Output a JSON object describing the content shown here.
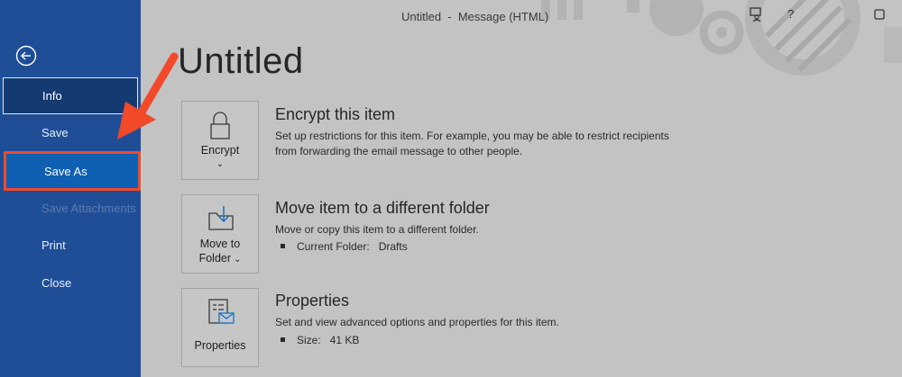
{
  "window": {
    "title": "Untitled  -  Message (HTML)"
  },
  "sidebar": {
    "items": [
      {
        "label": "Info"
      },
      {
        "label": "Save"
      },
      {
        "label": "Save As"
      },
      {
        "label": "Save Attachments"
      },
      {
        "label": "Print"
      },
      {
        "label": "Close"
      }
    ]
  },
  "main": {
    "title": "Untitled",
    "sections": [
      {
        "tile_label": "Encrypt",
        "title": "Encrypt this item",
        "desc_line1": "Set up restrictions for this item. For example, you may be able to restrict recipients",
        "desc_line2": "from forwarding the email message to other people."
      },
      {
        "tile_label_line1": "Move to",
        "tile_label_line2": "Folder",
        "title": "Move item to a different folder",
        "desc": "Move or copy this item to a different folder.",
        "bullet_label": "Current Folder:",
        "bullet_value": "Drafts"
      },
      {
        "tile_label": "Properties",
        "title": "Properties",
        "desc": "Set and view advanced options and properties for this item.",
        "bullet_label": "Size:",
        "bullet_value": "41 KB"
      }
    ]
  },
  "icons": {
    "back": "back-arrow-icon",
    "feedback": "feedback-icon",
    "help": "help-icon",
    "restore": "restore-icon",
    "encrypt": "lock-icon",
    "move": "move-to-folder-icon",
    "properties": "properties-icon"
  },
  "colors": {
    "sidebar": "#1f4e97",
    "sidebar_selected": "#143a72",
    "highlight_border": "#f2492b",
    "content_bg": "#c3c3c3"
  }
}
